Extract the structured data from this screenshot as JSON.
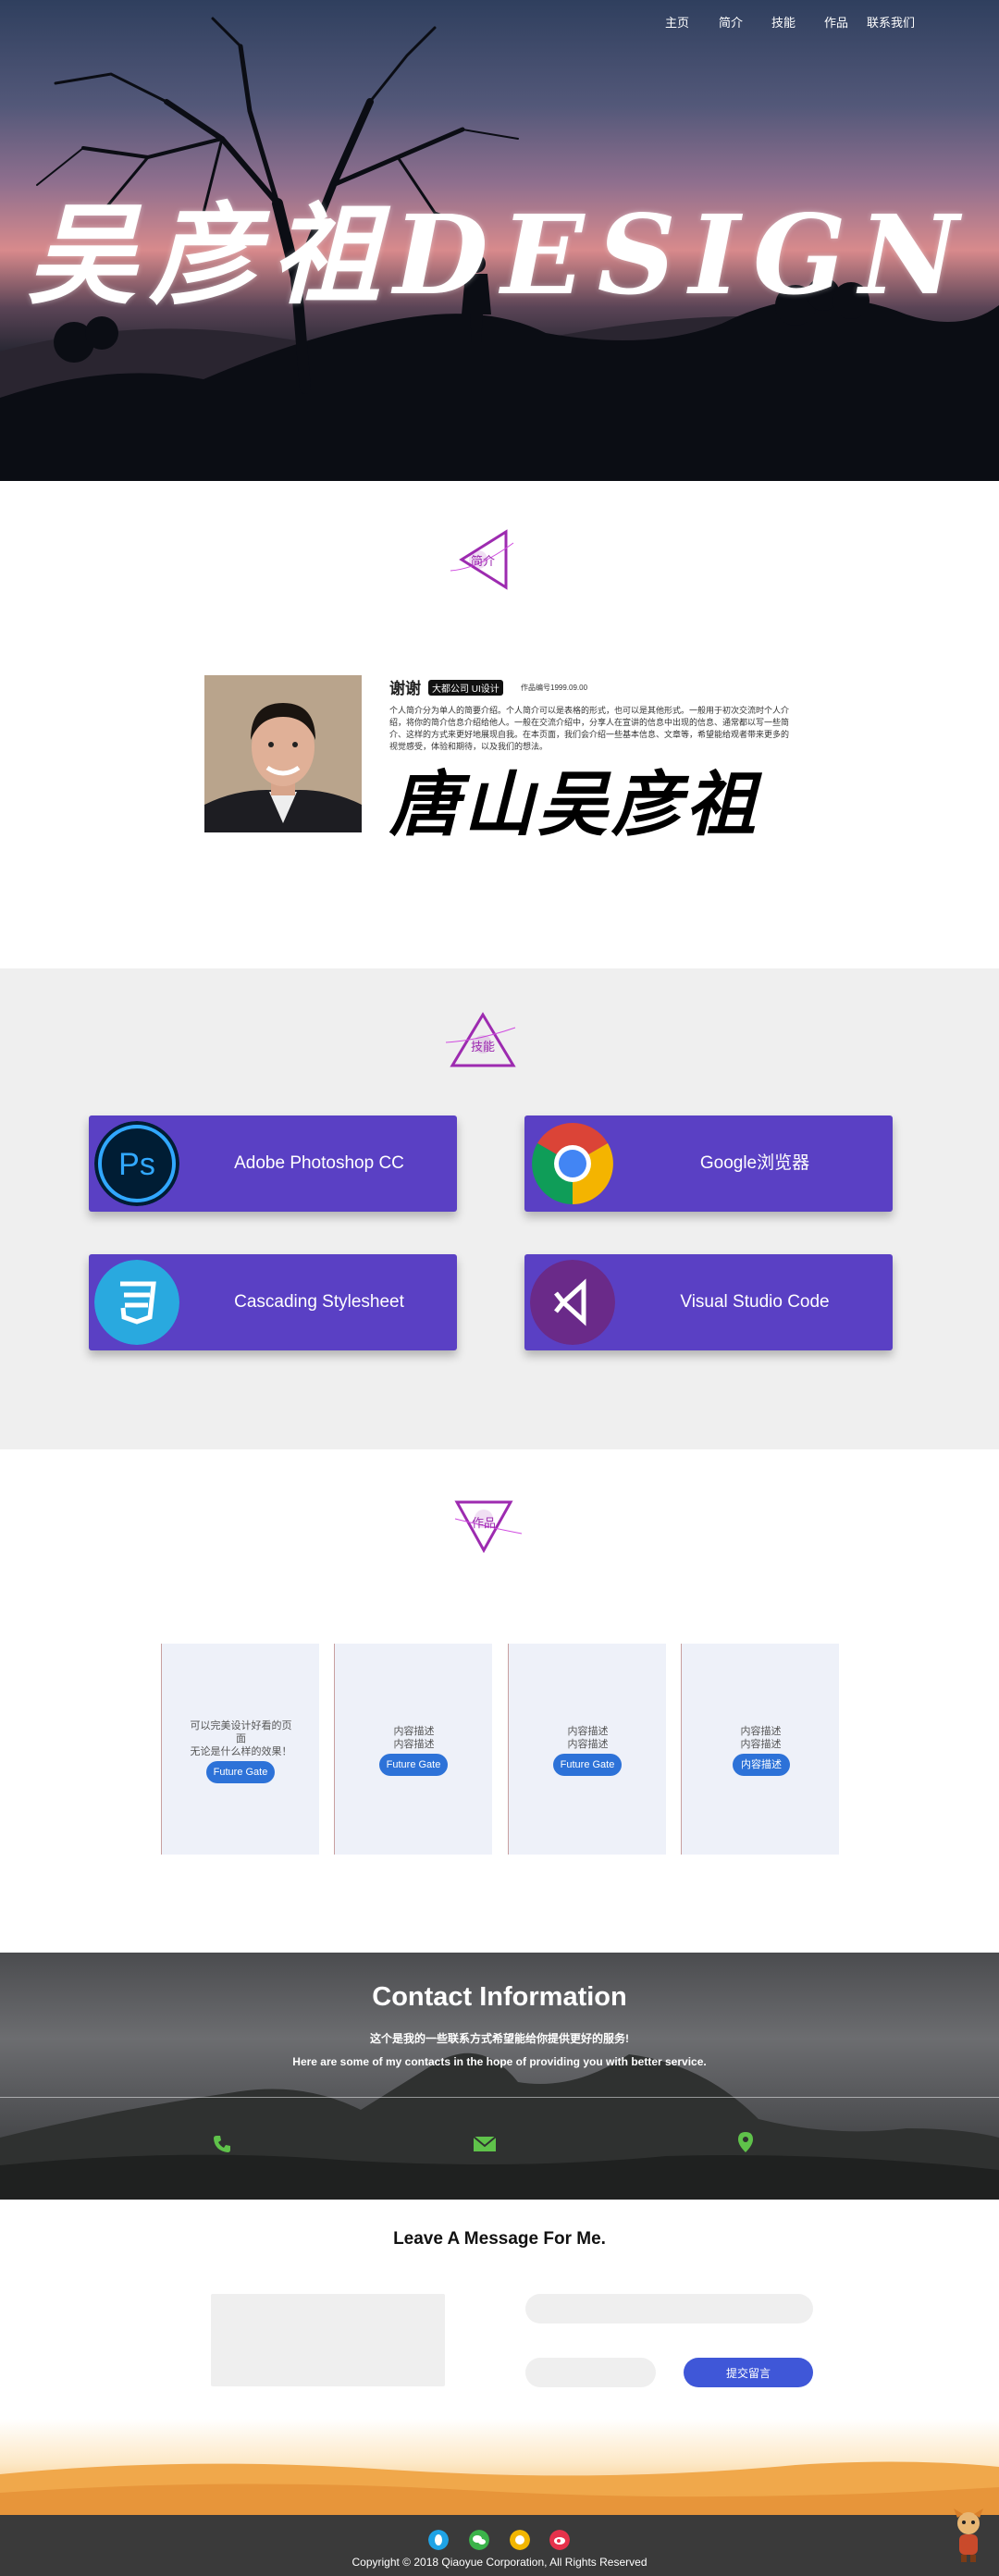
{
  "nav": {
    "items": [
      "主页",
      "简介",
      "技能",
      "作品",
      "联系我们"
    ]
  },
  "hero": {
    "title": "吴彦祖DESIGN"
  },
  "about": {
    "badge": "简介",
    "name": "谢谢",
    "tag": "大都公司   UI设计",
    "meta": "作品编号1999.09.00",
    "text": "个人简介分为单人的简要介绍。个人简介可以是表格的形式，也可以是其他形式。一般用于初次交流时个人介绍，将你的简介信息介绍给他人。一般在交流介绍中，分享人在宣讲的信息中出现的信息、通常都以写一些简介、这样的方式来更好地展现自我。在本页面，我们会介绍一些基本信息、文章等，希望能给观者带来更多的视觉感受，体验和期待，以及我们的想法。",
    "signature": "唐山吴彦祖"
  },
  "skills": {
    "badge": "技能",
    "items": [
      {
        "label": "Adobe Photoshop CC",
        "icon": "photoshop-icon"
      },
      {
        "label": "Google浏览器",
        "icon": "chrome-icon"
      },
      {
        "label": "Cascading Stylesheet",
        "icon": "css3-icon"
      },
      {
        "label": "Visual Studio Code",
        "icon": "vscode-icon"
      }
    ]
  },
  "works": {
    "badge": "作品",
    "cards": [
      {
        "line1": "可以完美设计好看的页",
        "line2": "面",
        "line3": "无论是什么样的效果！",
        "button": "Future Gate"
      },
      {
        "line1": "内容描述",
        "line2": "内容描述",
        "line3": "",
        "button": "Future Gate"
      },
      {
        "line1": "内容描述",
        "line2": "内容描述",
        "line3": "",
        "button": "Future Gate"
      },
      {
        "line1": "内容描述",
        "line2": "内容描述",
        "line3": "",
        "button": "内容描述"
      }
    ]
  },
  "contact": {
    "title": "Contact Information",
    "subtitle_cn": "这个是我的一些联系方式希望能给你提供更好的服务!",
    "subtitle_en": "Here are some of my contacts in the hope of providing you with better service.",
    "icons": [
      "phone-icon",
      "mail-icon",
      "location-icon"
    ],
    "accent": "#5fc24a"
  },
  "message": {
    "title": "Leave A Message For Me.",
    "fields": {
      "message": "",
      "email": "",
      "name": ""
    },
    "submit": "提交留言",
    "submit_color": "#3f57d8"
  },
  "footer": {
    "copyright": "Copyright © 2018 Qiaoyue Corporation, All Rights Reserved",
    "social": [
      "qq-icon",
      "wechat-icon",
      "sina-icon",
      "weibo-icon"
    ]
  }
}
